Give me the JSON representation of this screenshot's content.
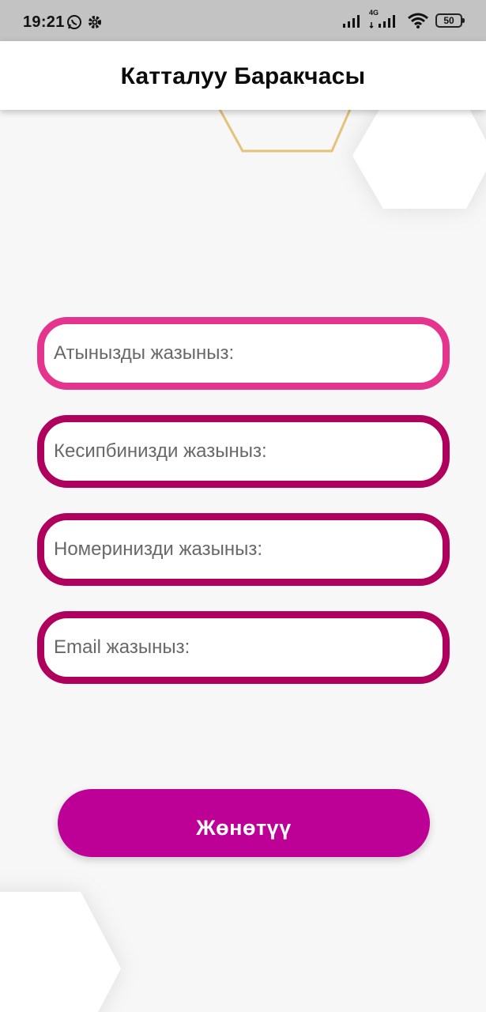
{
  "status_bar": {
    "time": "19:21",
    "network": "4G",
    "battery": "50",
    "icons": [
      "whatsapp-icon",
      "gear-icon",
      "signal-icon",
      "signal-4g-icon",
      "wifi-icon",
      "battery-icon"
    ]
  },
  "header": {
    "title": "Катталуу Баракчасы"
  },
  "form": {
    "name_placeholder": "Атынызды жазыныз:",
    "profession_placeholder": "Кесипбинизди жазыныз:",
    "phone_placeholder": "Номеринизди жазыныз:",
    "email_placeholder": "Email жазыныз:"
  },
  "actions": {
    "submit_label": "Жөнөтүү"
  },
  "colors": {
    "accent_active": "#e5348e",
    "field_border": "#b0005d",
    "button": "#bd0096",
    "hexagon_outline": "#e5c27a"
  }
}
